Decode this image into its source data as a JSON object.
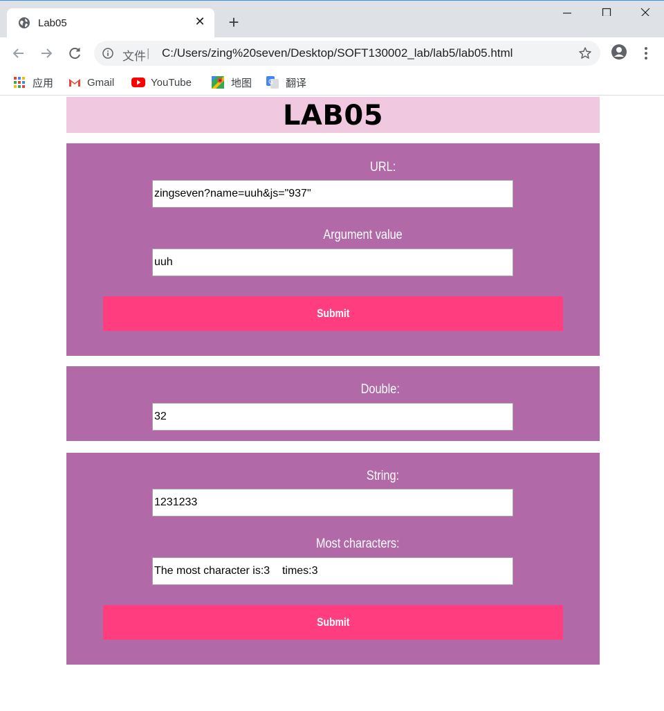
{
  "browser": {
    "tab_title": "Lab05",
    "address_scheme": "文件",
    "address_separator": "|",
    "url": "C:/Users/zing%20seven/Desktop/SOFT130002_lab/lab5/lab05.html",
    "bookmarks": [
      {
        "label": "应用",
        "icon": "apps-grid-icon"
      },
      {
        "label": "Gmail",
        "icon": "gmail-icon"
      },
      {
        "label": "YouTube",
        "icon": "youtube-icon"
      },
      {
        "label": "地图",
        "icon": "maps-icon"
      },
      {
        "label": "翻译",
        "icon": "translate-icon"
      }
    ]
  },
  "page": {
    "title": "LAB05",
    "url_form": {
      "url_label": "URL:",
      "url_value": "zingseven?name=uuh&js=\"937\"",
      "argument_label": "Argument value",
      "argument_value": "uuh",
      "submit_label": "Submit"
    },
    "double_form": {
      "label": "Double:",
      "value": "32"
    },
    "string_form": {
      "string_label": "String:",
      "string_value": "1231233",
      "most_label": "Most characters:",
      "most_value": "The most character is:3    times:3",
      "submit_label": "Submit"
    }
  },
  "colors": {
    "header_bg": "#f0c8e0",
    "panel_bg": "#b169a7",
    "button_bg": "#ff3d7f"
  }
}
